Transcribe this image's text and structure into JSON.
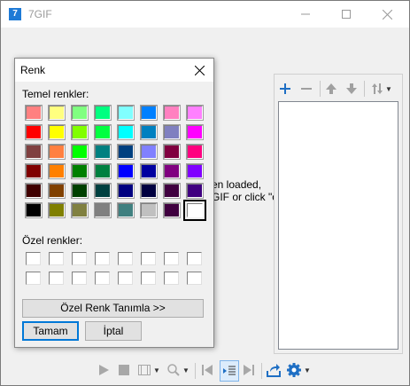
{
  "window": {
    "title": "7GIF",
    "icon": "7gif-app-icon"
  },
  "main": {
    "hint_lines": [
      "en loaded,",
      "GIF or click \"o"
    ]
  },
  "right_toolbar": [
    "add-icon",
    "remove-icon",
    "move-up-icon",
    "move-down-icon",
    "sort-icon"
  ],
  "bottom_toolbar": [
    "play-icon",
    "stop-icon",
    "frames-icon",
    "zoom-icon",
    "first-frame-icon",
    "frame-list-icon",
    "last-frame-icon",
    "share-icon",
    "settings-icon"
  ],
  "dialog": {
    "title": "Renk",
    "basic_colors_label": "Temel renkler:",
    "custom_colors_label": "Özel renkler:",
    "define_custom_label": "Özel Renk Tanımla >>",
    "ok_label": "Tamam",
    "cancel_label": "İptal",
    "selected_color": "#ffffff",
    "basic_colors": [
      [
        "#ff8080",
        "#ffff80",
        "#80ff80",
        "#00ff80",
        "#80ffff",
        "#0080ff",
        "#ff80c0",
        "#ff80ff"
      ],
      [
        "#ff0000",
        "#ffff00",
        "#80ff00",
        "#00ff40",
        "#00ffff",
        "#0080c0",
        "#8080c0",
        "#ff00ff"
      ],
      [
        "#804040",
        "#ff8040",
        "#00ff00",
        "#008080",
        "#004080",
        "#8080ff",
        "#800040",
        "#ff0080"
      ],
      [
        "#800000",
        "#ff8000",
        "#008000",
        "#008040",
        "#0000ff",
        "#0000a0",
        "#800080",
        "#8000ff"
      ],
      [
        "#400000",
        "#804000",
        "#004000",
        "#004040",
        "#000080",
        "#000040",
        "#400040",
        "#400080"
      ],
      [
        "#000000",
        "#808000",
        "#808040",
        "#808080",
        "#408080",
        "#c0c0c0",
        "#400040",
        "#ffffff"
      ]
    ],
    "custom_colors": [
      [
        "#ffffff",
        "#ffffff",
        "#ffffff",
        "#ffffff",
        "#ffffff",
        "#ffffff",
        "#ffffff",
        "#ffffff"
      ],
      [
        "#ffffff",
        "#ffffff",
        "#ffffff",
        "#ffffff",
        "#ffffff",
        "#ffffff",
        "#ffffff",
        "#ffffff"
      ]
    ]
  }
}
